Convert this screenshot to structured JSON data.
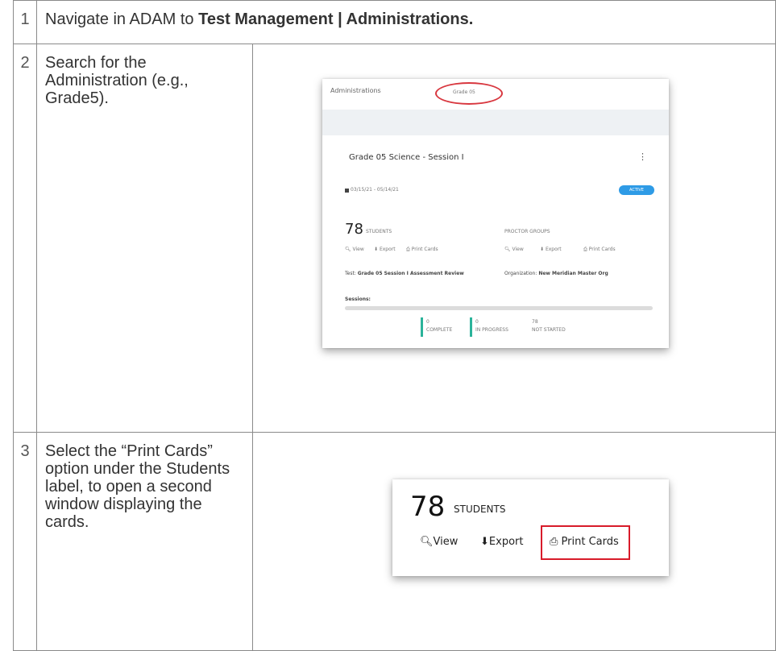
{
  "steps": [
    {
      "number": "1",
      "text_plain": "Navigate in ADAM to ",
      "text_bold": "Test Management | Administrations."
    },
    {
      "number": "2",
      "text": "Search for the Administration (e.g., Grade5)."
    },
    {
      "number": "3",
      "text": "Select the “Print Cards” option under the Students label, to open a second window displaying the cards."
    }
  ],
  "screenshot1": {
    "header_title": "Administrations",
    "search_text": "Grade 05",
    "card_title": "Grade 05 Science - Session I",
    "date_range": "03/15/21 - 05/14/21",
    "status_badge": "ACTIVE",
    "students_count": "78",
    "students_label": "STUDENTS",
    "proctor_label": "PROCTOR GROUPS",
    "view_label": "View",
    "export_label": "Export",
    "print_label": "Print Cards",
    "test_label": "Test:",
    "test_value": "Grade 05 Session I Assessment Review",
    "org_label": "Organization:",
    "org_value": "New Meridian Master Org",
    "sessions_label": "Sessions:",
    "stats": [
      {
        "value": "0",
        "label": "COMPLETE"
      },
      {
        "value": "0",
        "label": "IN PROGRESS"
      },
      {
        "value": "78",
        "label": "NOT STARTED"
      }
    ],
    "menu_glyph": "⋮",
    "accent_teal": "#2bb39a",
    "accent_blue": "#2e9be6",
    "search_circle_color": "#d8373f"
  },
  "screenshot2": {
    "students_count": "78",
    "students_label": "STUDENTS",
    "view_label": "View",
    "export_label": "Export",
    "print_label": "Print Cards",
    "highlight_color": "#d81b2a"
  }
}
